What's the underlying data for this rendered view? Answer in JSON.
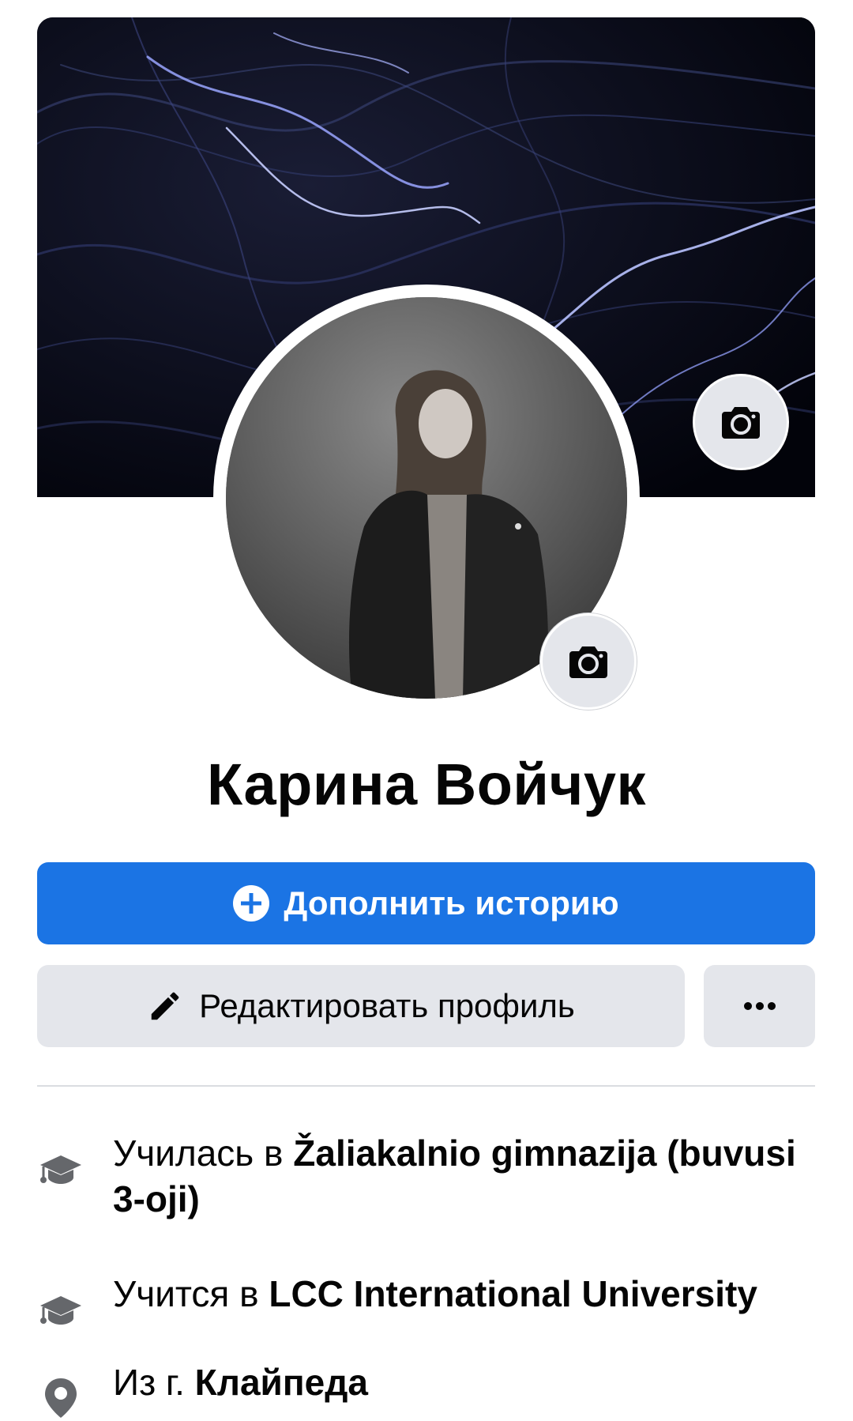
{
  "profile": {
    "name": "Карина Войчук"
  },
  "actions": {
    "add_story_label": "Дополнить историю",
    "edit_profile_label": "Редактировать профиль"
  },
  "intro": {
    "items": [
      {
        "icon": "graduation-cap-icon",
        "prefix": "Училась в",
        "value": "Žaliakalnio gimnazija (buvusi 3-oji)"
      },
      {
        "icon": "graduation-cap-icon",
        "prefix": "Учится в",
        "value": "LCC International University"
      },
      {
        "icon": "location-pin-icon",
        "prefix": "Из г.",
        "value": "Клайпеда"
      }
    ]
  },
  "colors": {
    "primary": "#1b74e4",
    "secondary_button": "#e4e6eb",
    "divider": "#dadde1",
    "icon_gray": "#65676b"
  }
}
